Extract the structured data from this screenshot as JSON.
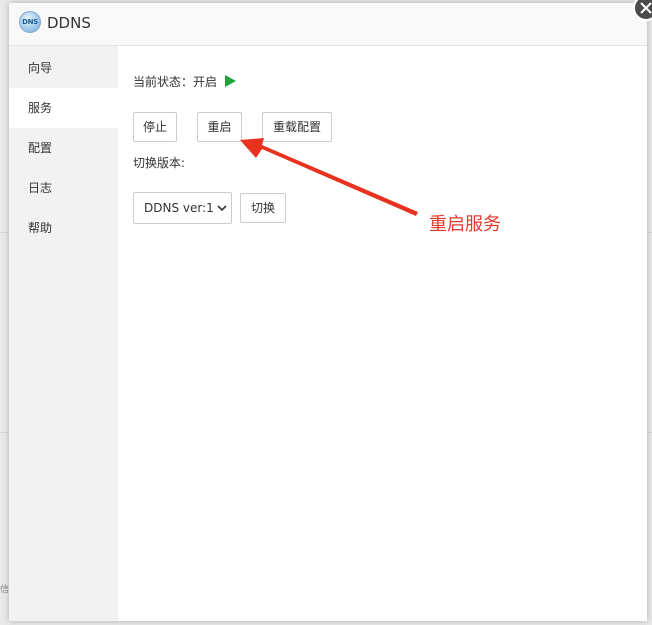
{
  "window": {
    "title": "DDNS",
    "app_icon_text": "DNS",
    "icon": "ddns-globe-icon",
    "close_icon": "close-icon"
  },
  "sidebar": {
    "items": [
      {
        "label": "向导"
      },
      {
        "label": "服务",
        "active": true
      },
      {
        "label": "配置"
      },
      {
        "label": "日志"
      },
      {
        "label": "帮助"
      }
    ]
  },
  "service": {
    "status_label": "当前状态：开启",
    "status_icon": "play-icon",
    "status_color": "#1fa33b",
    "buttons": {
      "stop": "停止",
      "restart": "重启",
      "reload_config": "重载配置"
    },
    "switch_version_label": "切换版本:",
    "version_select": {
      "selected": "DDNS ver:1"
    },
    "switch_button": "切换"
  },
  "annotation": {
    "text": "重启服务",
    "color": "#e23b2b"
  },
  "background": {
    "stub_text": "信"
  }
}
